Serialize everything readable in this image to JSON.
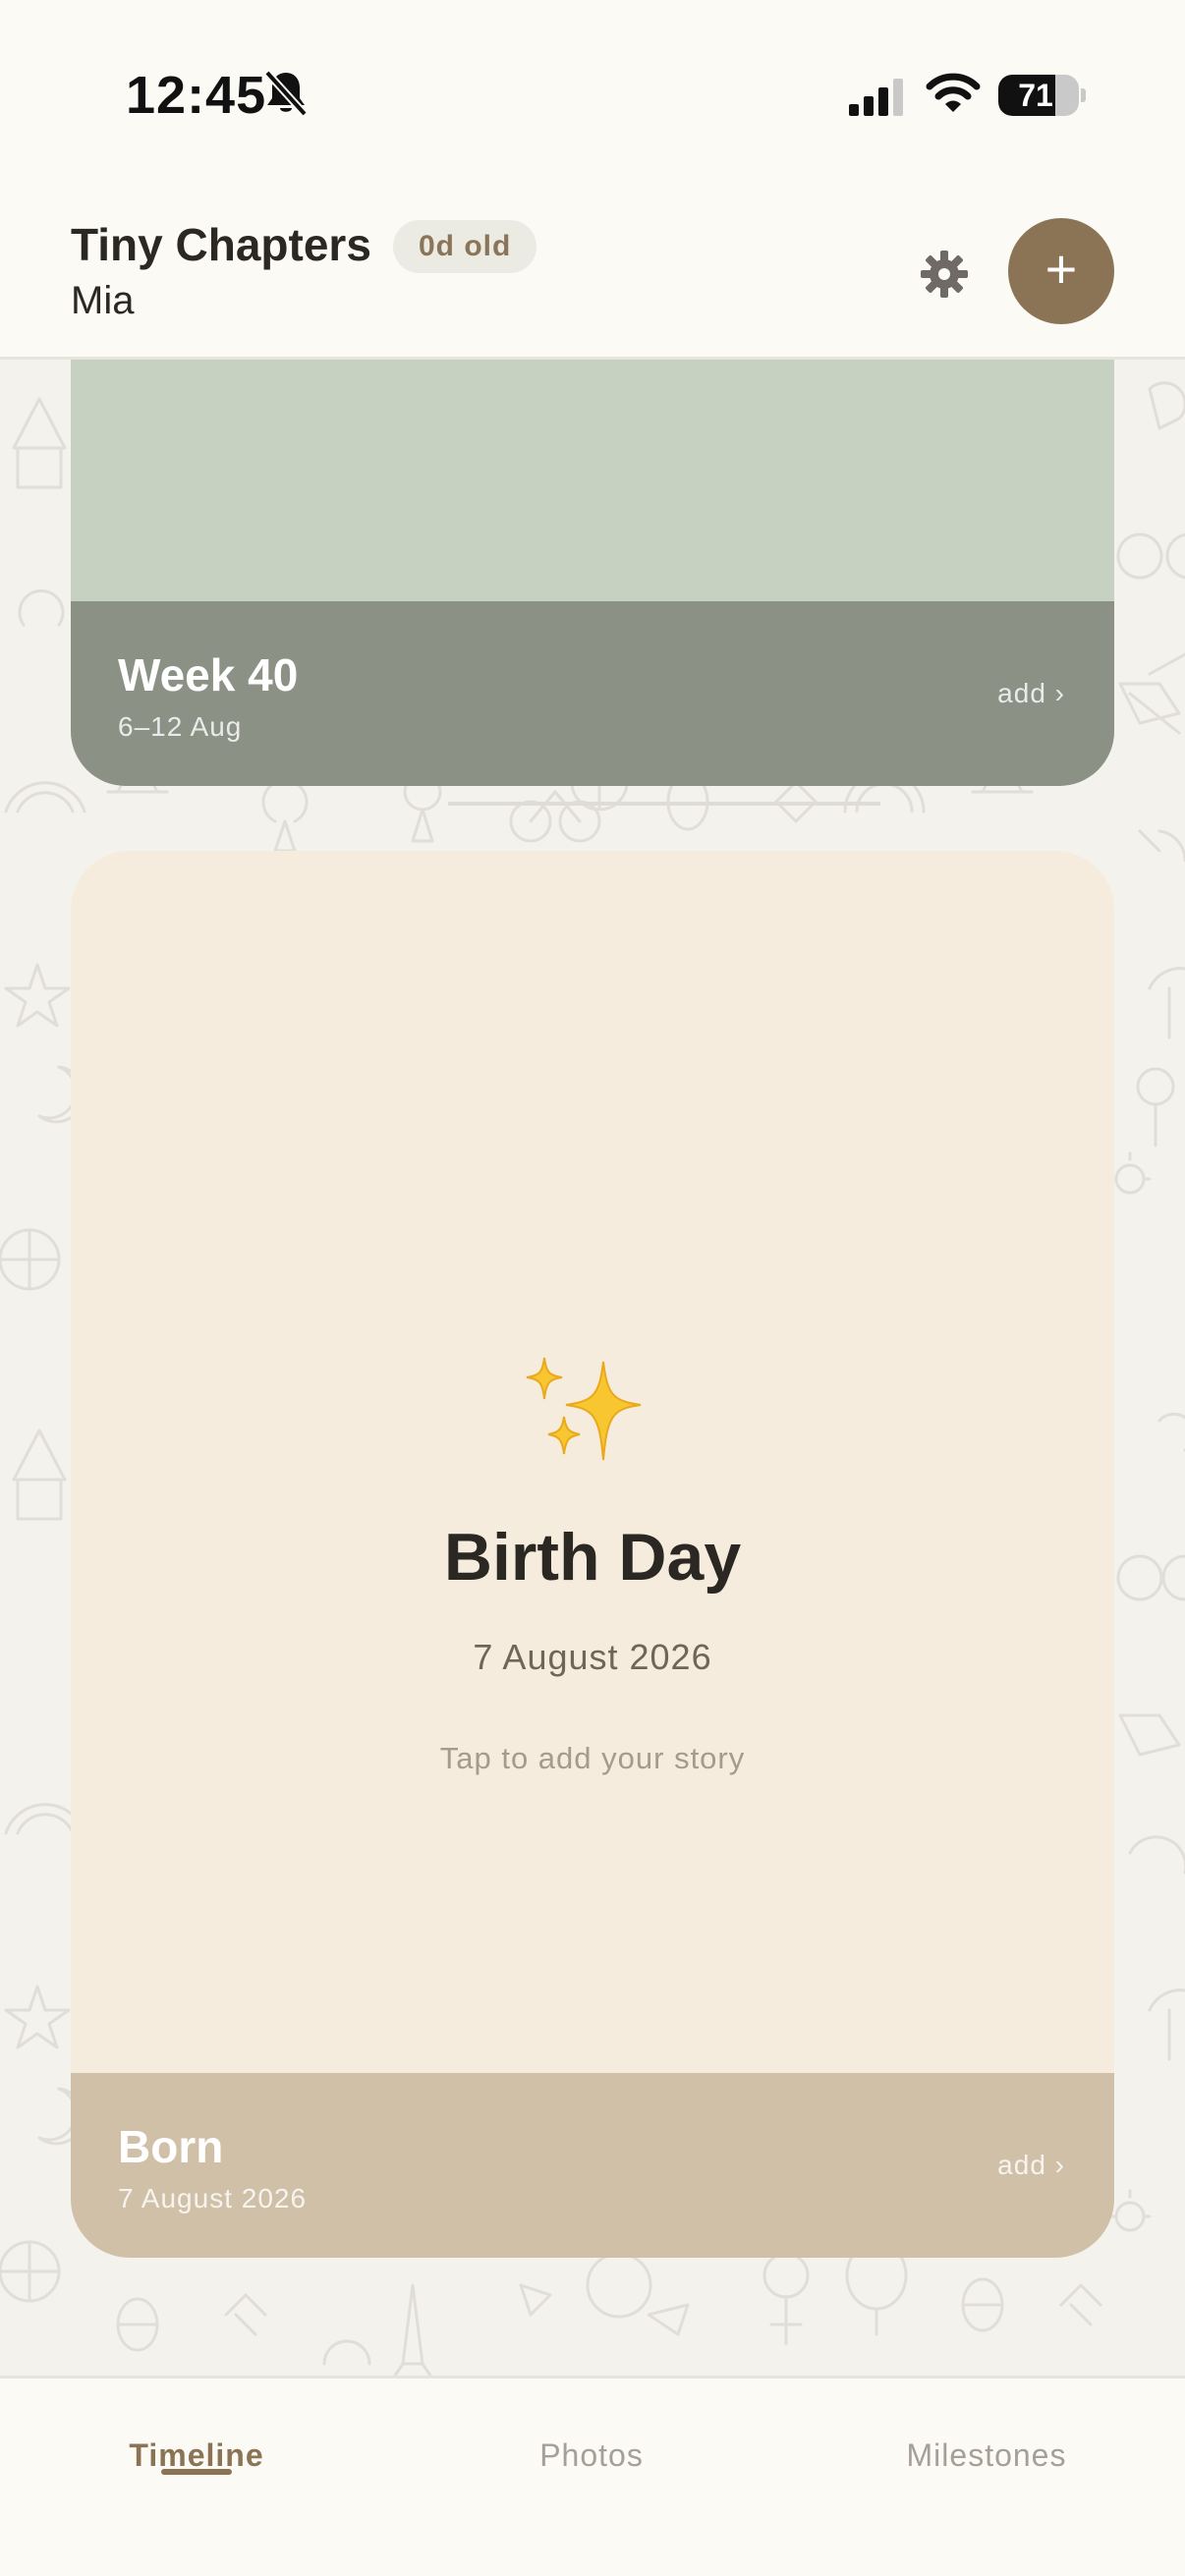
{
  "status_bar": {
    "time": "12:45",
    "battery_percent": 71,
    "icons": [
      "bell-slash-icon",
      "cellular-signal-icon",
      "wifi-icon",
      "battery-icon"
    ]
  },
  "header": {
    "app_title": "Tiny Chapters",
    "age_badge": "0d old",
    "child_name": "Mia",
    "settings_icon": "gear-icon",
    "add_icon": "plus-icon",
    "add_label": "+"
  },
  "timeline": {
    "week_card": {
      "title": "Week 40",
      "date_range": "6–12 Aug",
      "add_label": "add ›",
      "color": "#c7d1c1",
      "footer_color": "#8b9185"
    },
    "birth_card": {
      "icon": "sparkles-icon",
      "title": "Birth Day",
      "date": "7 August 2026",
      "hint": "Tap to add your story",
      "footer_title": "Born",
      "footer_date": "7 August 2026",
      "add_label": "add ›",
      "color": "#f6ecdd",
      "footer_color": "#d0c0a8"
    }
  },
  "bottom_nav": {
    "tabs": [
      {
        "label": "Timeline",
        "active": true
      },
      {
        "label": "Photos",
        "active": false
      },
      {
        "label": "Milestones",
        "active": false
      }
    ]
  },
  "colors": {
    "accent": "#8b7355",
    "background": "#fbfaf5"
  }
}
